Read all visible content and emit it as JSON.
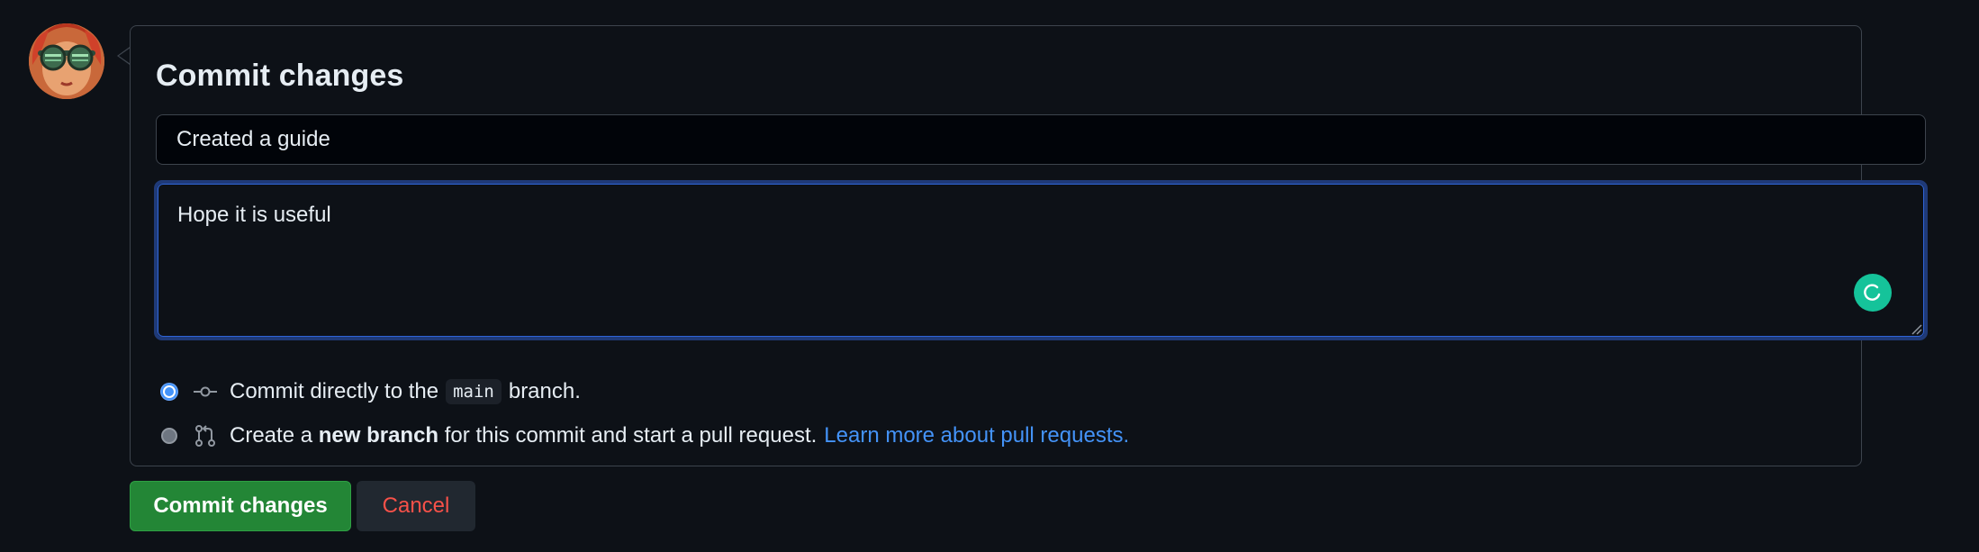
{
  "panel": {
    "title": "Commit changes"
  },
  "summary": {
    "value": "Created a guide"
  },
  "description": {
    "value": "Hope it is useful"
  },
  "options": {
    "direct": {
      "prefix": "Commit directly to the",
      "branch": "main",
      "suffix": "branch.",
      "selected": true,
      "icon": "git-commit-icon"
    },
    "new_branch": {
      "prefix": "Create a",
      "bold": "new branch",
      "suffix": "for this commit and start a pull request.",
      "link": "Learn more about pull requests.",
      "selected": false,
      "icon": "git-pull-request-icon"
    }
  },
  "buttons": {
    "commit": "Commit changes",
    "cancel": "Cancel"
  },
  "colors": {
    "background": "#0d1117",
    "primary_button": "#238636",
    "danger_text": "#f85149",
    "link": "#4493f8",
    "focus_ring": "#1f3a78",
    "grammar_badge": "#15c39a"
  }
}
